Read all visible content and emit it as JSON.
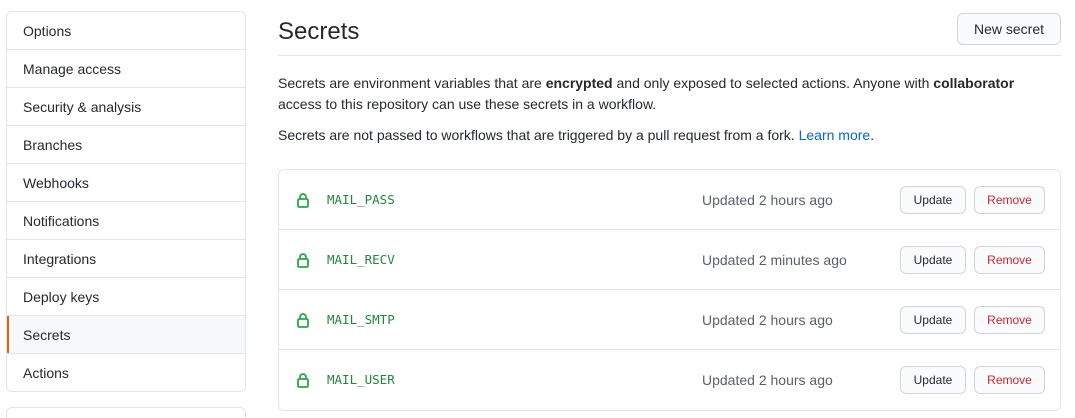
{
  "sidebar": {
    "items": [
      {
        "label": "Options"
      },
      {
        "label": "Manage access"
      },
      {
        "label": "Security & analysis"
      },
      {
        "label": "Branches"
      },
      {
        "label": "Webhooks"
      },
      {
        "label": "Notifications"
      },
      {
        "label": "Integrations"
      },
      {
        "label": "Deploy keys"
      },
      {
        "label": "Secrets",
        "selected": true
      },
      {
        "label": "Actions"
      }
    ]
  },
  "header": {
    "title": "Secrets",
    "new_secret_label": "New secret"
  },
  "description": {
    "part1": "Secrets are environment variables that are ",
    "bold1": "encrypted",
    "part2": " and only exposed to selected actions. Anyone with ",
    "bold2": "collaborator",
    "part3": " access to this repository can use these secrets in a workflow.",
    "note": "Secrets are not passed to workflows that are triggered by a pull request from a fork. ",
    "learn_more": "Learn more",
    "note_end": "."
  },
  "secrets": [
    {
      "name": "MAIL_PASS",
      "updated": "Updated 2 hours ago",
      "update_label": "Update",
      "remove_label": "Remove"
    },
    {
      "name": "MAIL_RECV",
      "updated": "Updated 2 minutes ago",
      "update_label": "Update",
      "remove_label": "Remove"
    },
    {
      "name": "MAIL_SMTP",
      "updated": "Updated 2 hours ago",
      "update_label": "Update",
      "remove_label": "Remove"
    },
    {
      "name": "MAIL_USER",
      "updated": "Updated 2 hours ago",
      "update_label": "Update",
      "remove_label": "Remove"
    }
  ],
  "colors": {
    "selected_indicator": "#e36209",
    "secret_name": "#22863a",
    "remove_text": "#cb2431",
    "link": "#0366d6"
  },
  "icons": {
    "secret_icon": "lock-icon"
  }
}
